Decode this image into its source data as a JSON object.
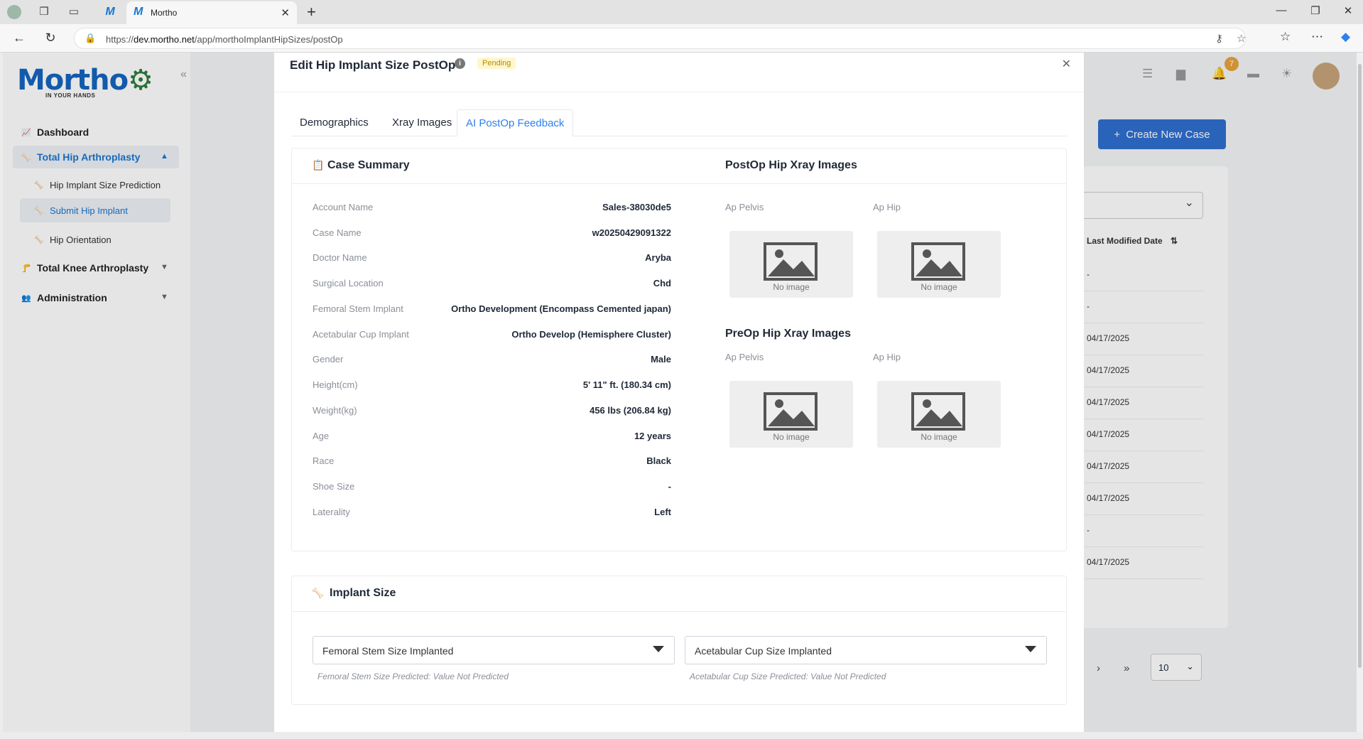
{
  "browser": {
    "tab_title": "Mortho",
    "url_prefix": "https://",
    "url_host": "dev.mortho.net",
    "url_path": "/app/morthoImplantHipSizes/postOp"
  },
  "sidebar": {
    "logo_text": "Mortho",
    "logo_tagline": "IN YOUR HANDS",
    "items": [
      {
        "label": "Dashboard"
      },
      {
        "label": "Total Hip Arthroplasty"
      },
      {
        "label": "Hip Implant Size Prediction"
      },
      {
        "label": "Submit Hip Implant"
      },
      {
        "label": "Hip Orientation"
      },
      {
        "label": "Total Knee Arthroplasty"
      },
      {
        "label": "Administration"
      }
    ]
  },
  "header": {
    "notification_count": "7"
  },
  "background": {
    "create_button": "Create New Case",
    "column_header": "Last Modified Date",
    "rows": [
      "-",
      "-",
      "04/17/2025",
      "04/17/2025",
      "04/17/2025",
      "04/17/2025",
      "04/17/2025",
      "04/17/2025",
      "-",
      "04/17/2025"
    ],
    "page_size": "10"
  },
  "modal": {
    "title": "Edit Hip Implant Size PostOp",
    "status": "Pending",
    "tabs": [
      "Demographics",
      "Xray Images",
      "AI PostOp Feedback"
    ],
    "case_summary": {
      "title": "Case Summary",
      "rows": [
        {
          "label": "Account Name",
          "value": "Sales-38030de5"
        },
        {
          "label": "Case Name",
          "value": "w20250429091322"
        },
        {
          "label": "Doctor Name",
          "value": "Aryba"
        },
        {
          "label": "Surgical Location",
          "value": "Chd"
        },
        {
          "label": "Femoral Stem Implant",
          "value": "Ortho Development (Encompass Cemented japan)"
        },
        {
          "label": "Acetabular Cup Implant",
          "value": "Ortho Develop (Hemisphere Cluster)"
        },
        {
          "label": "Gender",
          "value": "Male"
        },
        {
          "label": "Height(cm)",
          "value": "5' 11\" ft. (180.34 cm)"
        },
        {
          "label": "Weight(kg)",
          "value": "456 lbs (206.84 kg)"
        },
        {
          "label": "Age",
          "value": "12 years"
        },
        {
          "label": "Race",
          "value": "Black"
        },
        {
          "label": "Shoe Size",
          "value": "-"
        },
        {
          "label": "Laterality",
          "value": "Left"
        }
      ]
    },
    "postop_xray": {
      "title": "PostOp Hip Xray Images",
      "labels": [
        "Ap Pelvis",
        "Ap Hip"
      ],
      "placeholder": "No image"
    },
    "preop_xray": {
      "title": "PreOp Hip Xray Images",
      "labels": [
        "Ap Pelvis",
        "Ap Hip"
      ],
      "placeholder": "No image"
    },
    "implant_size": {
      "title": "Implant Size",
      "femoral_select": "Femoral Stem Size Implanted",
      "acetabular_select": "Acetabular Cup Size Implanted",
      "femoral_hint": "Femoral Stem Size Predicted: Value Not Predicted",
      "acetabular_hint": "Acetabular Cup Size Predicted: Value Not Predicted"
    }
  },
  "colors": {
    "accent": "#2f80ed",
    "primary_button": "#2f6fd0",
    "pending_badge": "#fff6cc"
  }
}
